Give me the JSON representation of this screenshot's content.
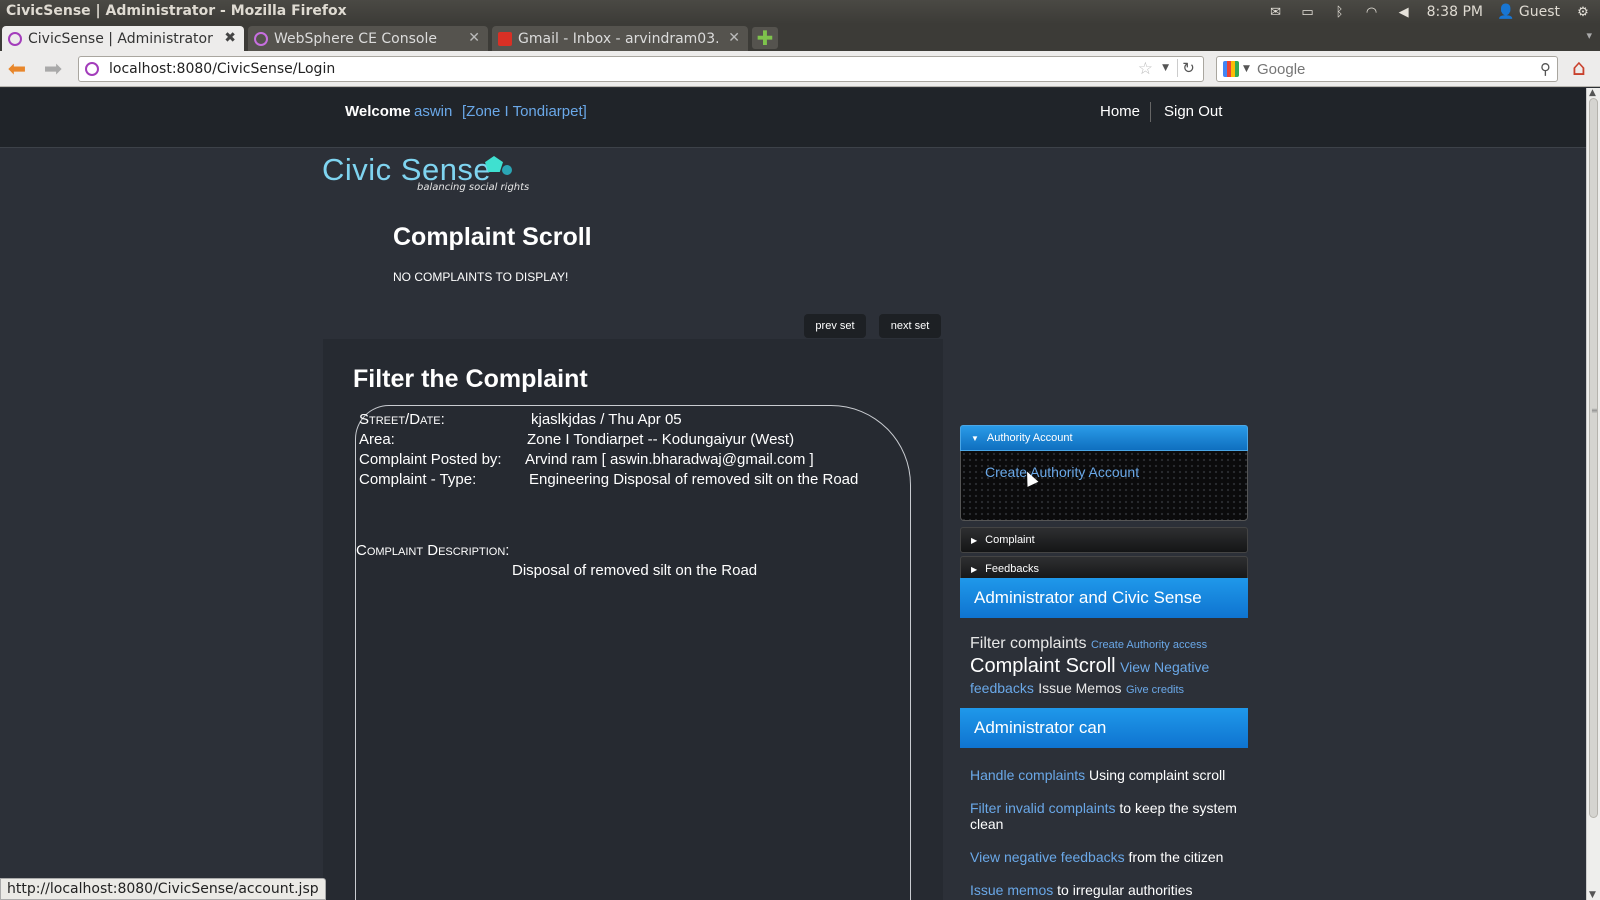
{
  "os": {
    "window_title": "CivicSense | Administrator - Mozilla Firefox",
    "clock": "8:38 PM",
    "user": "Guest"
  },
  "browser": {
    "tabs": [
      {
        "label": "CivicSense | Administrator",
        "close": "✖"
      },
      {
        "label": "WebSphere CE Console",
        "close": "✕"
      },
      {
        "label": "Gmail - Inbox - arvindram03...",
        "close": "✕"
      }
    ],
    "new_tab": "✚",
    "url": "localhost:8080/CivicSense/Login",
    "search_placeholder": "Google",
    "status_url": "http://localhost:8080/CivicSense/account.jsp"
  },
  "header": {
    "welcome": "Welcome",
    "username": "aswin",
    "zone": "[Zone I Tondiarpet]",
    "home": "Home",
    "signout": "Sign Out"
  },
  "logo": {
    "name": "Civic Sense",
    "tagline": "balancing social rights"
  },
  "scroll": {
    "title": "Complaint Scroll",
    "message": "NO COMPLAINTS TO DISPLAY!",
    "prev": "prev set",
    "next": "next set"
  },
  "filter": {
    "title": "Filter the Complaint",
    "fields": [
      {
        "label": "Street/Date:",
        "value": "kjaslkjdas / Thu Apr 05"
      },
      {
        "label": "Area:",
        "value": "Zone I Tondiarpet -- Kodungaiyur (West)"
      },
      {
        "label": "Complaint Posted by:",
        "value": "Arvind ram [ aswin.bharadwaj@gmail.com ]"
      },
      {
        "label": "Complaint - Type:",
        "value": "Engineering Disposal of removed silt on the Road"
      }
    ],
    "description_label": "Complaint Description:",
    "description": "Disposal of removed silt on the Road"
  },
  "sidebar": {
    "accordion": [
      {
        "label": "Authority Account",
        "open": true,
        "link": "Create Authority Account"
      },
      {
        "label": "Complaint",
        "open": false
      },
      {
        "label": "Feedbacks",
        "open": false
      }
    ],
    "admin_civic_title": "Administrator and Civic Sense",
    "tags": {
      "filter": "Filter complaints",
      "create_access": "Create Authority access",
      "scroll": "Complaint Scroll",
      "negative": "View Negative feedbacks",
      "memos": "Issue Memos",
      "credits": "Give credits"
    },
    "admin_can_title": "Administrator can",
    "can_items": [
      {
        "link": "Handle complaints",
        "text": " Using complaint scroll"
      },
      {
        "link": "Filter invalid complaints",
        "text": " to keep the system clean"
      },
      {
        "link": "View negative feedbacks",
        "text": " from the citizen"
      },
      {
        "link": "Issue memos",
        "text": " to irregular authorities"
      }
    ]
  },
  "colors": {
    "link": "#6aa8e8",
    "accent_blue": "#0f74d0",
    "page_bg": "#2c3038"
  },
  "icons": [
    "mail-icon",
    "battery-icon",
    "bluetooth-icon",
    "wifi-icon",
    "volume-icon",
    "user-icon",
    "settings-icon",
    "back-arrow-icon",
    "forward-arrow-icon",
    "bookmark-star-icon",
    "reload-icon",
    "search-icon",
    "home-icon"
  ]
}
